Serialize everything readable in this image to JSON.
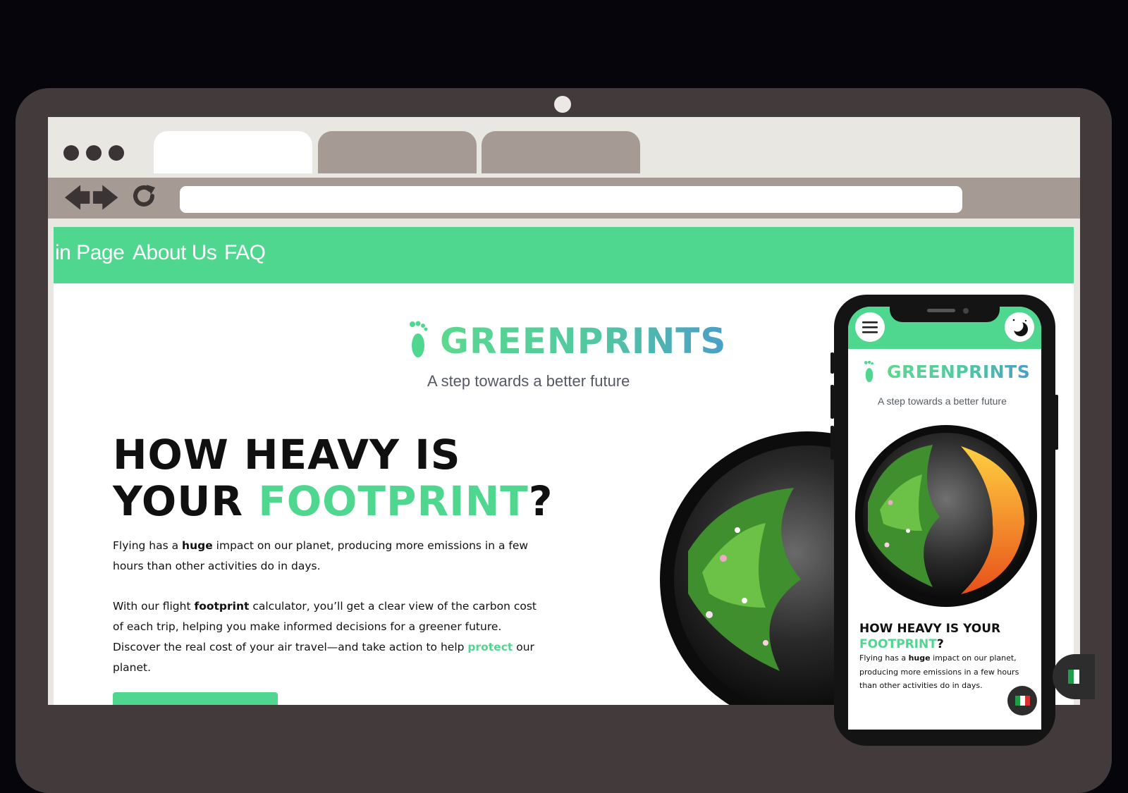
{
  "nav": {
    "items": [
      "in Page",
      "About Us",
      "FAQ"
    ]
  },
  "brand": {
    "name": "GREENPRINTS",
    "tagline": "A step towards a better future"
  },
  "hero": {
    "title_line1": "HOW HEAVY IS",
    "title_line2_prefix": "YOUR ",
    "title_highlight": "FOOTPRINT",
    "title_suffix": "?",
    "para1": {
      "t1": "Flying has a ",
      "b1": "huge",
      "t2": " impact on our planet, producing more emissions in a few hours than other activities do in days."
    },
    "para2": {
      "t1": "With our flight ",
      "b1": "footprint",
      "t2": " calculator, you’ll get a clear view of the carbon cost of each trip, helping you make informed decisions for a greener future. Discover the real cost of your air travel—and take action to help ",
      "g1": "protect",
      "t3": " our planet."
    }
  },
  "mobile": {
    "brand_name": "GREENPRINTS",
    "tagline": "A step towards a better future",
    "title_prefix": "HOW HEAVY IS YOUR ",
    "title_highlight": "FOOTPRINT",
    "title_suffix": "?",
    "para": {
      "t1": "Flying has a ",
      "b1": "huge",
      "t2": " impact on our planet, producing more emissions in a few hours than other activities do in days."
    }
  },
  "colors": {
    "accent": "#50d78f",
    "laptop_frame": "#433a3b",
    "background": "#07050c"
  },
  "icons": {
    "menu": "hamburger-menu-icon",
    "theme": "moon-icon",
    "language": "italy-flag-icon",
    "logo": "footprint-icon"
  }
}
